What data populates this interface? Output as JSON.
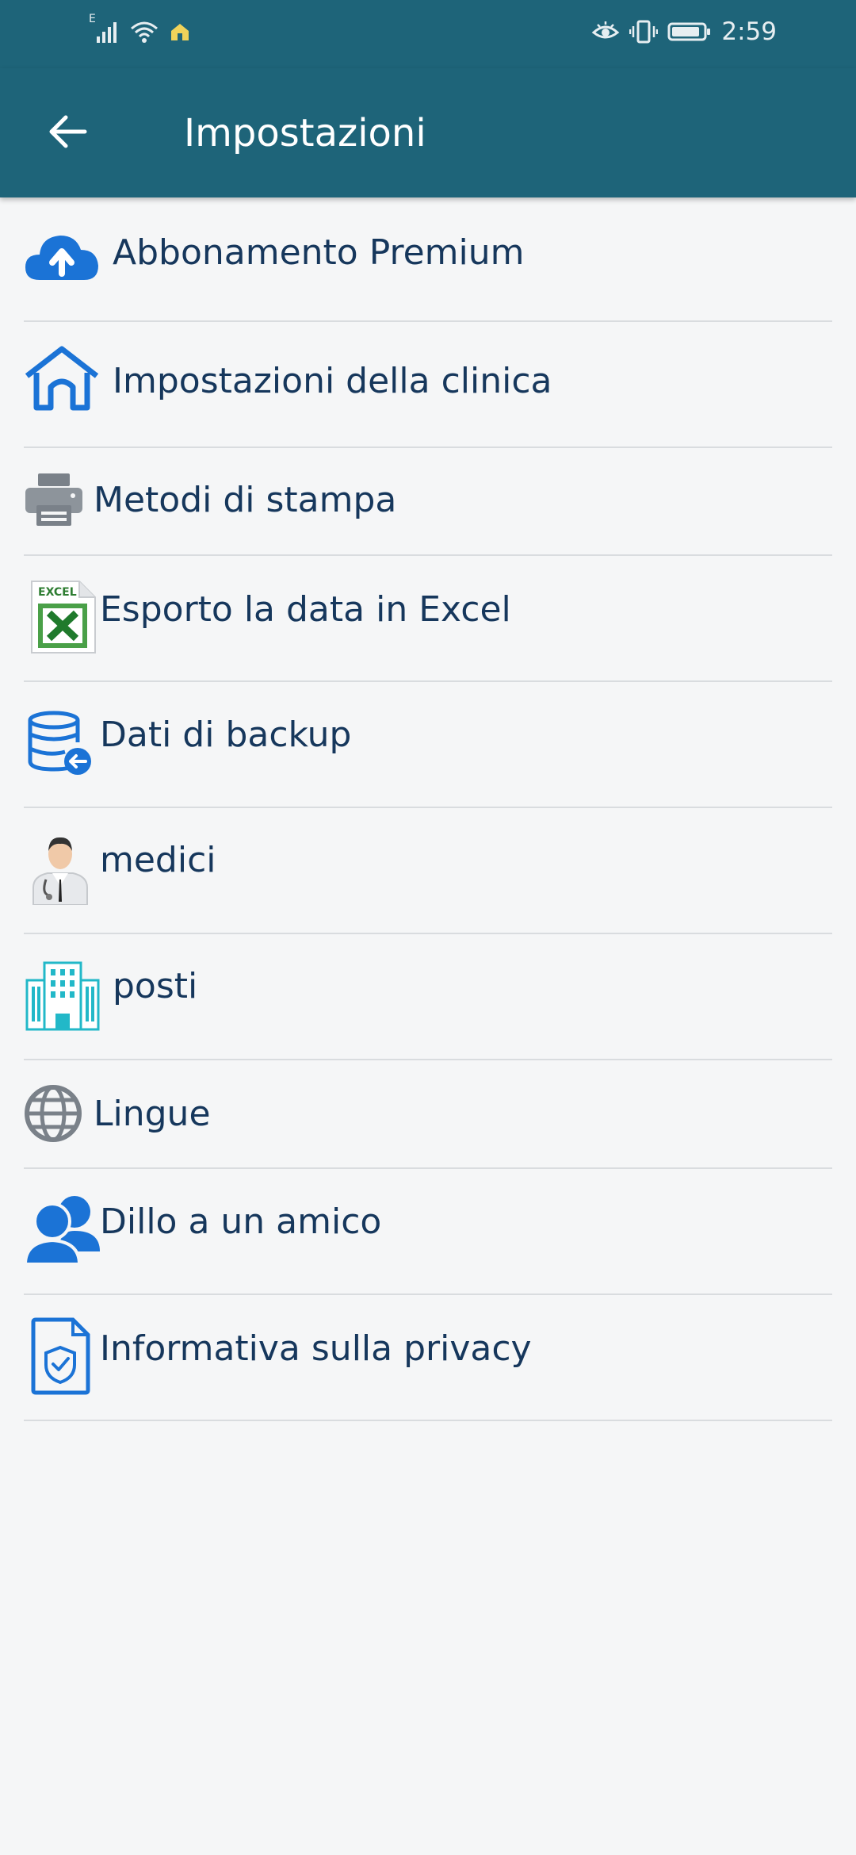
{
  "status_bar": {
    "network_indicator": "E",
    "time": "2:59",
    "icons": [
      "signal-icon",
      "wifi-icon",
      "notification-icon",
      "eye-comfort-icon",
      "vibrate-icon",
      "battery-icon"
    ]
  },
  "app_bar": {
    "title": "Impostazioni",
    "back_icon": "arrow-left-icon",
    "color": "#1e6479"
  },
  "settings": {
    "items": [
      {
        "label": "Abbonamento Premium",
        "icon": "cloud-upload-icon"
      },
      {
        "label": "Impostazioni della clinica",
        "icon": "home-icon"
      },
      {
        "label": "Metodi di stampa",
        "icon": "printer-icon"
      },
      {
        "label": "Esporto la data in Excel",
        "icon": "excel-file-icon",
        "icon_text": "EXCEL"
      },
      {
        "label": "Dati di backup",
        "icon": "database-backup-icon"
      },
      {
        "label": "medici",
        "icon": "doctor-icon"
      },
      {
        "label": "posti",
        "icon": "hospital-building-icon"
      },
      {
        "label": "Lingue",
        "icon": "globe-icon"
      },
      {
        "label": "Dillo a un amico",
        "icon": "users-icon"
      },
      {
        "label": "Informativa sulla privacy",
        "icon": "shield-document-icon"
      }
    ]
  },
  "colors": {
    "primary": "#1e6479",
    "icon_blue": "#1b73d6",
    "text": "#16375c",
    "divider": "#d9dcdf",
    "background": "#f5f6f7"
  }
}
